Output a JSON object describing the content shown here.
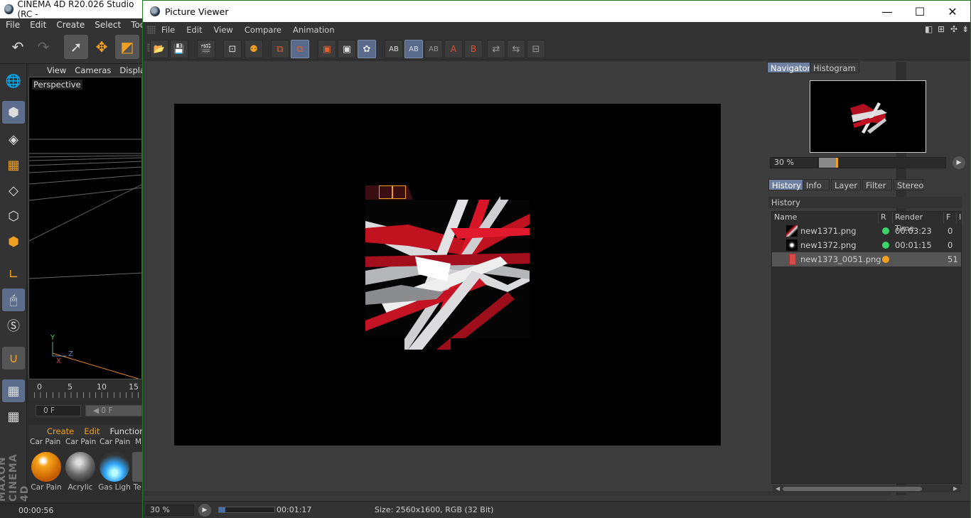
{
  "main_window": {
    "title": "CINEMA 4D R20.026 Studio (RC -",
    "menu": [
      "File",
      "Edit",
      "Create",
      "Select",
      "Tools"
    ],
    "viewport_menu": [
      "View",
      "Cameras",
      "Display"
    ],
    "viewport_label": "Perspective",
    "axis_labels": {
      "y": "Y",
      "z": "Z",
      "x": "X"
    },
    "timeline_ticks": [
      "0",
      "5",
      "10",
      "15"
    ],
    "frame_field": "0 F",
    "frame_field2": "0 F",
    "material_menu": [
      "Create",
      "Edit",
      "Function"
    ],
    "materials_top": [
      "Car Pain",
      "Car Pain",
      "Car Pain",
      "M"
    ],
    "materials": [
      "Car Pain",
      "Acrylic",
      "Gas Ligh",
      "Te"
    ],
    "brand": "MAXON CINEMA 4D",
    "status_time": "00:00:56"
  },
  "picture_viewer": {
    "title": "Picture Viewer",
    "menu": [
      "File",
      "Edit",
      "View",
      "Compare",
      "Animation"
    ],
    "navigator_tabs": [
      "Navigator",
      "Histogram"
    ],
    "navigator_zoom": "30 %",
    "navigator_slider_fraction": 0.15,
    "history_tabs": [
      "History",
      "Info",
      "Layer",
      "Filter",
      "Stereo"
    ],
    "history_title": "History",
    "history_columns": [
      "Name",
      "R",
      "Render Time",
      "F",
      "I"
    ],
    "history_rows": [
      {
        "name": "new1371.png",
        "status_color": "#3cd36a",
        "render_time": "00:03:23",
        "f": "0"
      },
      {
        "name": "new1372.png",
        "status_color": "#3cd36a",
        "render_time": "00:01:15",
        "f": "0"
      },
      {
        "name": "new1373_0051.png",
        "status_color": "#f0a020",
        "render_time": "",
        "f": "51"
      }
    ],
    "status_zoom": "30 %",
    "progress_fraction": 0.12,
    "elapsed_time": "00:01:17",
    "image_info": "Size: 2560x1600, RGB (32 Bit)"
  },
  "colors": {
    "accent_tab": "#6f7fa0",
    "render_red": "#d0142a",
    "bucket_outline": "#f0a020"
  }
}
